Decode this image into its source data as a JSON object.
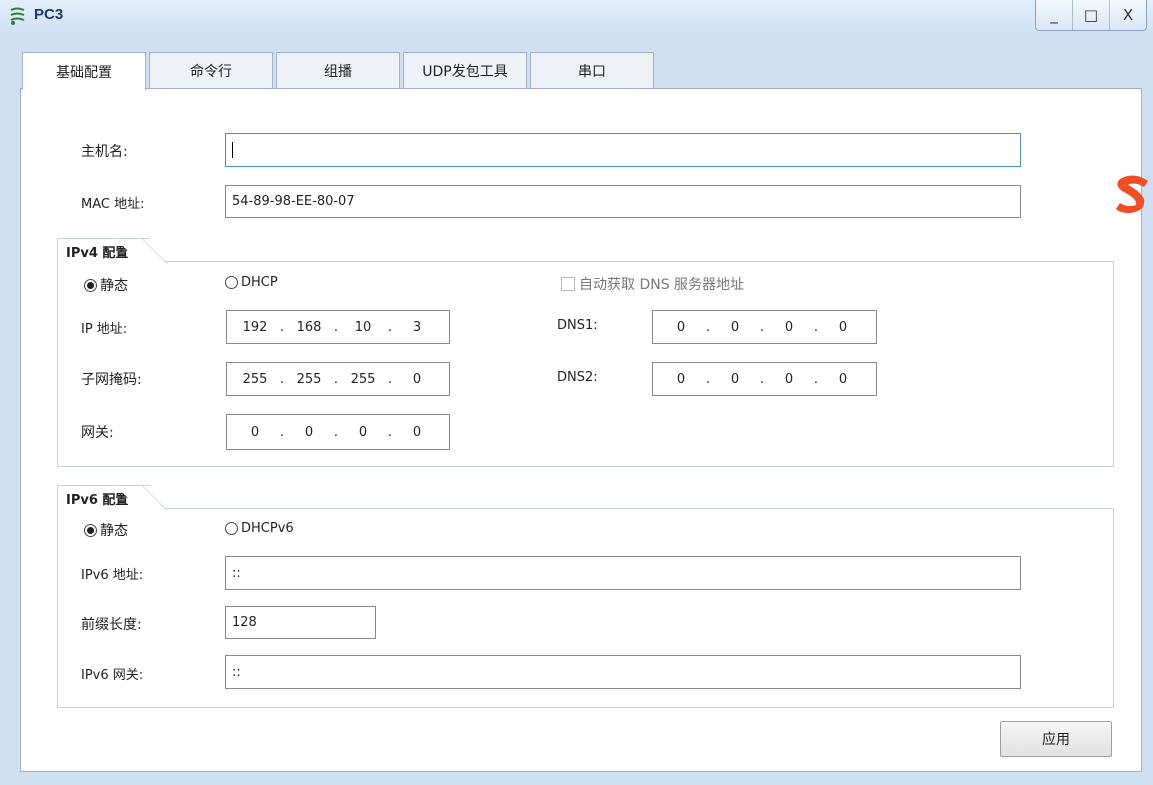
{
  "window": {
    "title": "PC3",
    "minimize": "_",
    "maximize": "□",
    "close": "X"
  },
  "tabs": [
    {
      "label": "基础配置"
    },
    {
      "label": "命令行"
    },
    {
      "label": "组播"
    },
    {
      "label": "UDP发包工具"
    },
    {
      "label": "串口"
    }
  ],
  "basic": {
    "hostname_label": "主机名:",
    "hostname_value": "",
    "mac_label": "MAC 地址:",
    "mac_value": "54-89-98-EE-80-07"
  },
  "ipv4": {
    "title": "IPv4 配置",
    "static_label": "静态",
    "dhcp_label": "DHCP",
    "auto_dns_label": "自动获取 DNS 服务器地址",
    "ip_label": "IP 地址:",
    "ip": [
      "192",
      "168",
      "10",
      "3"
    ],
    "mask_label": "子网掩码:",
    "mask": [
      "255",
      "255",
      "255",
      "0"
    ],
    "gateway_label": "网关:",
    "gateway": [
      "0",
      "0",
      "0",
      "0"
    ],
    "dns1_label": "DNS1:",
    "dns1": [
      "0",
      "0",
      "0",
      "0"
    ],
    "dns2_label": "DNS2:",
    "dns2": [
      "0",
      "0",
      "0",
      "0"
    ]
  },
  "ipv6": {
    "title": "IPv6 配置",
    "static_label": "静态",
    "dhcp_label": "DHCPv6",
    "addr_label": "IPv6 地址:",
    "addr_value": "::",
    "prefix_label": "前缀长度:",
    "prefix_value": "128",
    "gateway_label": "IPv6 网关:",
    "gateway_value": "::"
  },
  "apply_label": "应用",
  "colors": {
    "window_bg": "#cfe0f3",
    "focus_border": "#4a90d9",
    "sogou": "#f04e23"
  }
}
